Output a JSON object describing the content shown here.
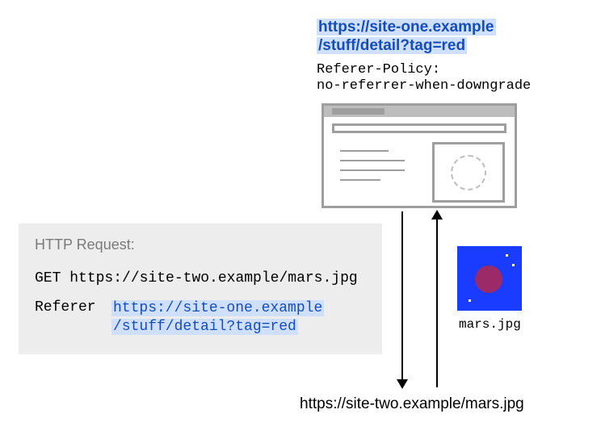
{
  "top_url_line1": "https://site-one.example",
  "top_url_line2": "/stuff/detail?tag=red",
  "policy_line1": "Referer-Policy:",
  "policy_line2": "no-referrer-when-downgrade",
  "request_label": "HTTP Request:",
  "request_method": "GET",
  "request_target": "https://site-two.example/mars.jpg",
  "referer_header": "Referer",
  "referer_line1": "https://site-one.example",
  "referer_line2": "/stuff/detail?tag=red",
  "mars_caption": "mars.jpg",
  "bottom_url": "https://site-two.example/mars.jpg"
}
